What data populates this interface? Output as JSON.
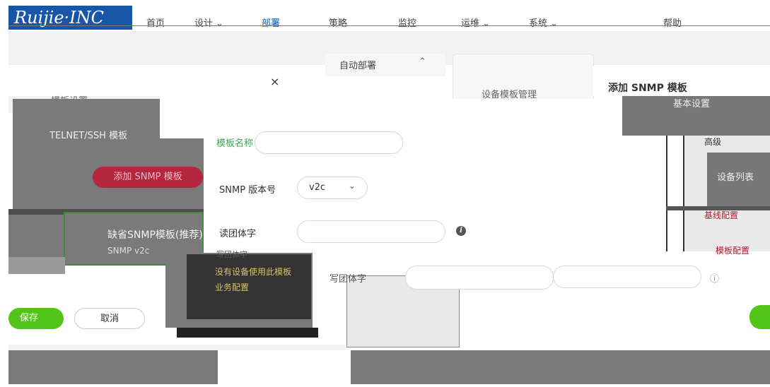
{
  "nav": {
    "logo": "Ruijie·INC",
    "items": [
      "首页",
      "设计",
      "部署",
      "策略",
      "监控",
      "运维",
      "系统",
      "帮助"
    ]
  },
  "left": {
    "top_link": "模板设置",
    "telnet_template": "TELNET/SSH 模板",
    "add_snmp_btn": "添加 SNMP 模板",
    "default_template": "缺省SNMP模板(推荐)",
    "snmp_version_line": "SNMP v2c",
    "save_label": "保存",
    "cancel_label": "取消",
    "close_icon": "close-icon"
  },
  "center": {
    "auto_deploy": "自动部署",
    "device_template_mgmt": "设备模板管理",
    "no_device_msg": "没有设备使用此模板",
    "business_config": "业务配置",
    "write_community": "写团体字"
  },
  "dialog": {
    "name_label": "模板名称",
    "version_label": "SNMP 版本号",
    "version_value": "v2c",
    "read_label": "读团体字",
    "write_label": "写团体字"
  },
  "right": {
    "title": "添加 SNMP 模板",
    "section_label": "基本设置",
    "advanced_label": "高级",
    "device_list": "设备列表",
    "link_config": "基线配置",
    "template_config": "模板配置"
  },
  "colors": {
    "accent_green": "#52c41a",
    "accent_red": "#c0152f",
    "brand_blue": "#1a56a8"
  }
}
